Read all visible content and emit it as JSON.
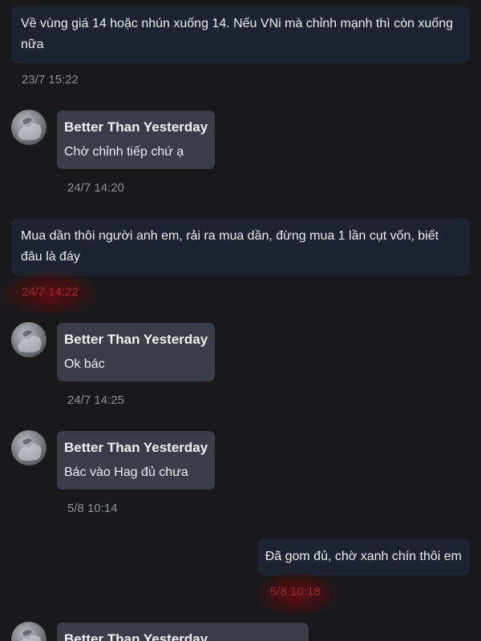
{
  "messages": [
    {
      "type": "outgoing",
      "text": "Về vùng giá 14 hoặc nhún xuống 14. Nếu VNi mà chỉnh mạnh thì còn xuống nữa",
      "time": "23/7 15:22"
    },
    {
      "type": "incoming",
      "sender": "Better Than Yesterday",
      "text": "Chờ chỉnh tiếp chứ ạ",
      "time": "24/7 14:20"
    },
    {
      "type": "outgoing",
      "text": "Mua dần thôi người anh em, rải ra mua dần, đừng mua 1 lần cụt vốn, biết đâu là đáy",
      "time": "24/7 14:22"
    },
    {
      "type": "incoming",
      "sender": "Better Than Yesterday",
      "text": "Ok bác",
      "time": "24/7 14:25"
    },
    {
      "type": "incoming",
      "sender": "Better Than Yesterday",
      "text": "Bác vào Hag đủ chưa",
      "time": "5/8 10:14"
    },
    {
      "type": "outgoing",
      "text": "Đã gom đủ, chờ xanh chín thôi em",
      "time": "5/8 10:18"
    },
    {
      "type": "incoming",
      "sender": "Better Than Yesterday",
      "text": ""
    }
  ],
  "colors": {
    "background": "#19191b",
    "outgoing_bubble": "#1d2330",
    "incoming_bubble": "#3a3c47",
    "timestamp": "#8c8f97",
    "highlight": "#9a2a2e"
  }
}
